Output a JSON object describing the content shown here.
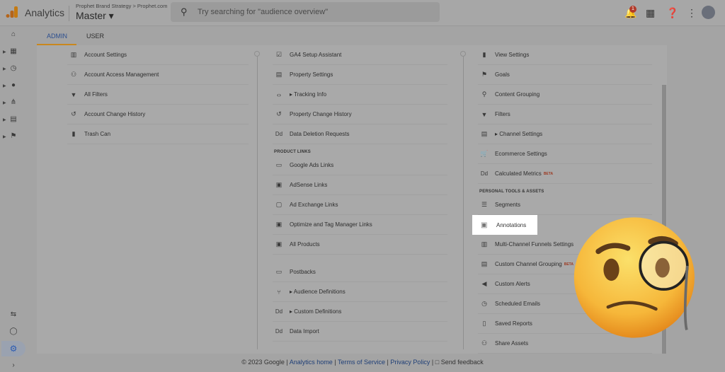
{
  "header": {
    "app_name": "Analytics",
    "breadcrumb": "Prophet Brand Strategy > Prophet.com",
    "view": "Master ▾",
    "search_placeholder": "Try searching for \"audience overview\"",
    "notification_count": "1"
  },
  "tabs": [
    {
      "label": "ADMIN",
      "active": true
    },
    {
      "label": "USER",
      "active": false
    }
  ],
  "accent": "#c9871e",
  "account_column": [
    {
      "icon": "building-icon",
      "label": "Account Settings"
    },
    {
      "icon": "people-icon",
      "label": "Account Access Management"
    },
    {
      "icon": "filter-icon",
      "label": "All Filters"
    },
    {
      "icon": "history-icon",
      "label": "Account Change History"
    },
    {
      "icon": "trash-icon",
      "label": "Trash Can"
    }
  ],
  "property_column": {
    "items": [
      {
        "icon": "checklist-icon",
        "label": "GA4 Setup Assistant"
      },
      {
        "icon": "property-icon",
        "label": "Property Settings"
      },
      {
        "icon": "code-icon",
        "label": "▸ Tracking Info"
      },
      {
        "icon": "history-icon",
        "label": "Property Change History"
      },
      {
        "icon": "dd-icon",
        "label": "Data Deletion Requests"
      }
    ],
    "section": "PRODUCT LINKS",
    "links": [
      {
        "icon": "ads-icon",
        "label": "Google Ads Links"
      },
      {
        "icon": "adsense-icon",
        "label": "AdSense Links"
      },
      {
        "icon": "adexchange-icon",
        "label": "Ad Exchange Links"
      },
      {
        "icon": "link-icon",
        "label": "Optimize and Tag Manager Links"
      },
      {
        "icon": "link-icon",
        "label": "All Products"
      }
    ],
    "more": [
      {
        "icon": "postback-icon",
        "label": "Postbacks"
      },
      {
        "icon": "fork-icon",
        "label": "▸ Audience Definitions"
      },
      {
        "icon": "dd-icon",
        "label": "▸ Custom Definitions"
      },
      {
        "icon": "dd-icon",
        "label": "Data Import"
      }
    ]
  },
  "view_column": {
    "items": [
      {
        "icon": "doc-icon",
        "label": "View Settings"
      },
      {
        "icon": "flag-icon",
        "label": "Goals"
      },
      {
        "icon": "grouping-icon",
        "label": "Content Grouping"
      },
      {
        "icon": "filter-icon",
        "label": "Filters"
      },
      {
        "icon": "channel-icon",
        "label": "▸ Channel Settings"
      },
      {
        "icon": "cart-icon",
        "label": "Ecommerce Settings"
      },
      {
        "icon": "dd-icon",
        "label": "Calculated Metrics",
        "beta": "BETA"
      }
    ],
    "section": "PERSONAL TOOLS & ASSETS",
    "tools": [
      {
        "icon": "segments-icon",
        "label": "Segments"
      },
      {
        "icon": "comment-icon",
        "label": "Annotations",
        "highlighted": true
      },
      {
        "icon": "bar-chart-icon",
        "label": "Multi-Channel Funnels Settings"
      },
      {
        "icon": "channel-icon",
        "label": "Custom Channel Grouping",
        "beta": "BETA"
      },
      {
        "icon": "megaphone-icon",
        "label": "Custom Alerts"
      },
      {
        "icon": "clock-icon",
        "label": "Scheduled Emails"
      },
      {
        "icon": "file-icon",
        "label": "Saved Reports"
      },
      {
        "icon": "share-icon",
        "label": "Share Assets"
      }
    ]
  },
  "footer": {
    "copyright": "© 2023 Google |",
    "home": "Analytics home",
    "tos": "Terms of Service",
    "privacy": "Privacy Policy",
    "feedback": "Send feedback"
  }
}
